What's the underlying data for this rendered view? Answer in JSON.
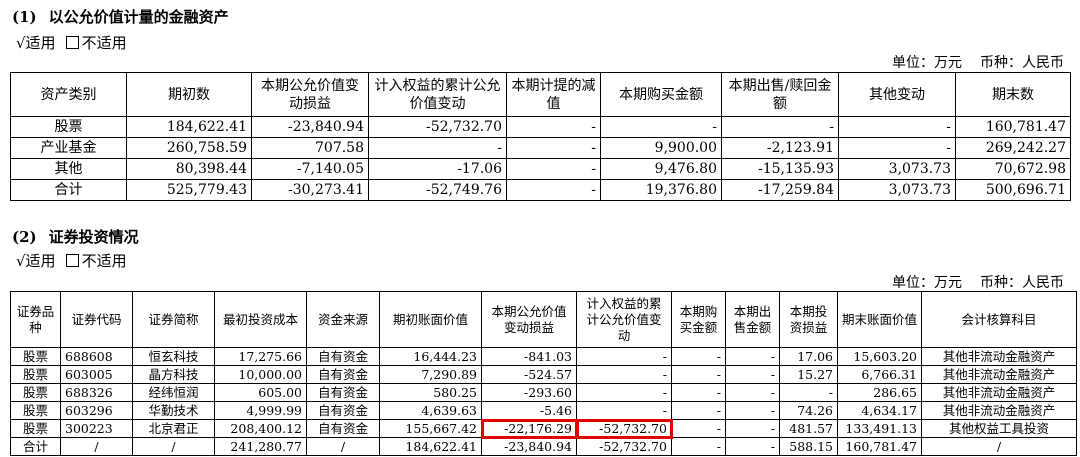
{
  "section1": {
    "number": "(1)",
    "title": "以公允价值计量的金融资产",
    "applicable": "√适用",
    "not_applicable": "不适用",
    "unit": "单位：万元",
    "currency": "币种：人民币",
    "headers": [
      "资产类别",
      "期初数",
      "本期公允价值变动损益",
      "计入权益的累计公允价值变动",
      "本期计提的减值",
      "本期购买金额",
      "本期出售/赎回金额",
      "其他变动",
      "期末数"
    ],
    "rows": [
      [
        "股票",
        "184,622.41",
        "-23,840.94",
        "-52,732.70",
        "-",
        "-",
        "-",
        "-",
        "160,781.47"
      ],
      [
        "产业基金",
        "260,758.59",
        "707.58",
        "-",
        "-",
        "9,900.00",
        "-2,123.91",
        "-",
        "269,242.27"
      ],
      [
        "其他",
        "80,398.44",
        "-7,140.05",
        "-17.06",
        "-",
        "9,476.80",
        "-15,135.93",
        "3,073.73",
        "70,672.98"
      ],
      [
        "合计",
        "525,779.43",
        "-30,273.41",
        "-52,749.76",
        "-",
        "19,376.80",
        "-17,259.84",
        "3,073.73",
        "500,696.71"
      ]
    ]
  },
  "section2": {
    "number": "(2)",
    "title": "证券投资情况",
    "applicable": "√适用",
    "not_applicable": "不适用",
    "unit": "单位：万元",
    "currency": "币种：人民币",
    "headers": [
      "证券品种",
      "证券代码",
      "证券简称",
      "最初投资成本",
      "资金来源",
      "期初账面价值",
      "本期公允价值变动损益",
      "计入权益的累计公允价值变动",
      "本期购买金额",
      "本期出售金额",
      "本期投资损益",
      "期末账面价值",
      "会计核算科目"
    ],
    "rows": [
      [
        "股票",
        "688608",
        "恒玄科技",
        "17,275.66",
        "自有资金",
        "16,444.23",
        "-841.03",
        "-",
        "-",
        "-",
        "17.06",
        "15,603.20",
        "其他非流动金融资产"
      ],
      [
        "股票",
        "603005",
        "晶方科技",
        "10,000.00",
        "自有资金",
        "7,290.89",
        "-524.57",
        "-",
        "-",
        "-",
        "15.27",
        "6,766.31",
        "其他非流动金融资产"
      ],
      [
        "股票",
        "688326",
        "经纬恒润",
        "605.00",
        "自有资金",
        "580.25",
        "-293.60",
        "-",
        "-",
        "-",
        "-",
        "286.65",
        "其他非流动金融资产"
      ],
      [
        "股票",
        "603296",
        "华勤技术",
        "4,999.99",
        "自有资金",
        "4,639.63",
        "-5.46",
        "-",
        "-",
        "-",
        "74.26",
        "4,634.17",
        "其他非流动金融资产"
      ],
      [
        "股票",
        "300223",
        "北京君正",
        "208,400.12",
        "自有资金",
        "155,667.42",
        "-22,176.29",
        "-52,732.70",
        "-",
        "-",
        "481.57",
        "133,491.13",
        "其他权益工具投资"
      ],
      [
        "合计",
        "/",
        "/",
        "241,280.77",
        "/",
        "184,622.41",
        "-23,840.94",
        "-52,732.70",
        "-",
        "-",
        "588.15",
        "160,781.47",
        "/"
      ]
    ]
  },
  "highlight_color": "#e00000"
}
